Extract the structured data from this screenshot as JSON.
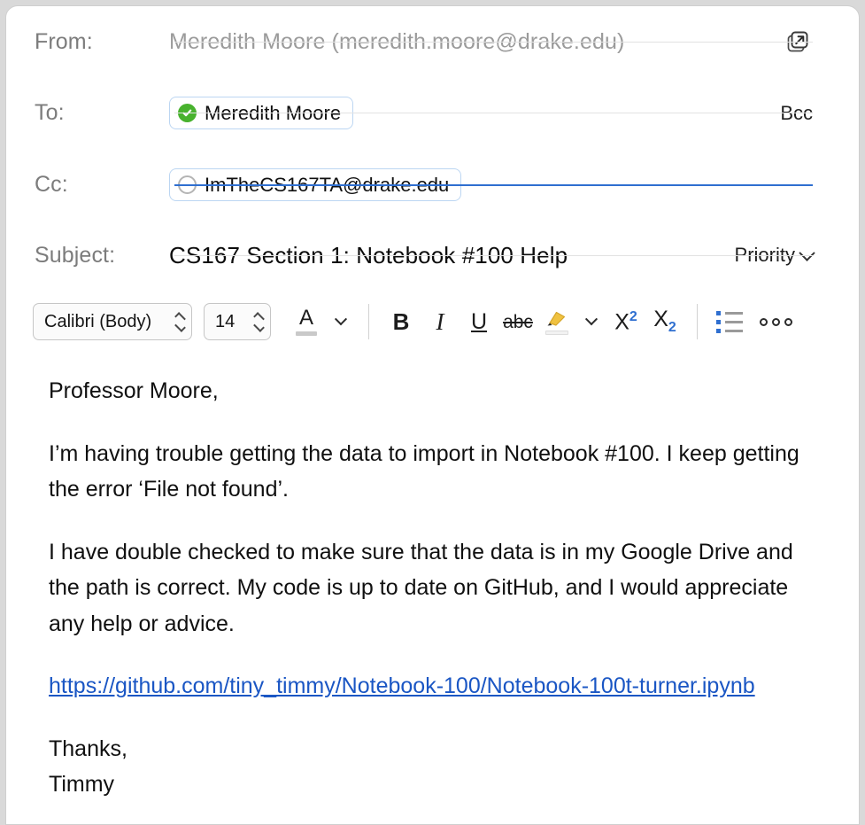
{
  "window": {
    "title": "Email Compose"
  },
  "headers": {
    "from": {
      "label": "From:",
      "value": "Meredith Moore (meredith.moore@drake.edu)",
      "popout_icon": "open-in-new-window-icon"
    },
    "to": {
      "label": "To:",
      "recipient": "Meredith Moore",
      "status_icon": "verified-check-icon",
      "bcc_label": "Bcc"
    },
    "cc": {
      "label": "Cc:",
      "recipient": "ImTheCS167TA@drake.edu",
      "status_icon": "empty-circle-icon"
    },
    "subject": {
      "label": "Subject:",
      "value": "CS167 Section 1: Notebook #100 Help",
      "priority_label": "Priority"
    }
  },
  "toolbar": {
    "font_family": "Calibri (Body)",
    "font_size": "14",
    "font_color_icon": "font-color-a-icon",
    "bold": "B",
    "italic": "I",
    "underline": "U",
    "strikethrough": "abc",
    "highlight_icon": "highlighter-pen-icon",
    "superscript": "X",
    "superscript_exp": "2",
    "subscript": "X",
    "subscript_exp": "2",
    "bullets_icon": "bulleted-list-icon",
    "overflow_icon": "more-options-icon"
  },
  "body": {
    "greeting": "Professor Moore,",
    "paragraph_1": "I’m having trouble getting the data to import in Notebook #100. I keep getting the error ‘File not found’.",
    "paragraph_2": "I have double checked to make sure that the data is in my Google Drive and the path is correct. My code is up to date on GitHub, and I would appreciate any help or advice.",
    "link": "https://github.com/tiny_timmy/Notebook-100/Notebook-100t-turner.ipynb",
    "closing": "Thanks,",
    "signature": "Timmy"
  },
  "colors": {
    "accent_blue": "#2f6fd0",
    "link_blue": "#1a56c4",
    "verified_green": "#48b22e",
    "label_gray": "#7c7c7c",
    "placeholder_gray": "#9b9b9b"
  }
}
